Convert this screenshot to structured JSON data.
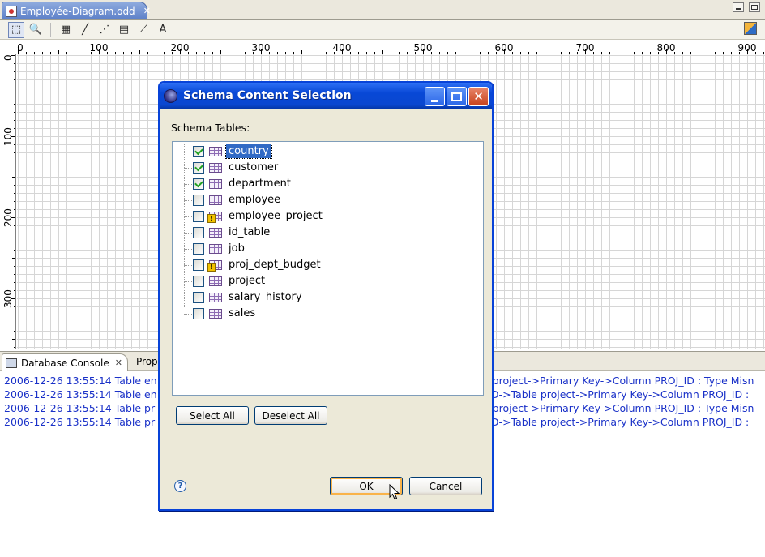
{
  "editor": {
    "tab_title": "Employée-Diagram.odd",
    "tab_close": "✕"
  },
  "toolbar": {
    "tools": [
      {
        "name": "select-tool",
        "glyph": "⬚"
      },
      {
        "name": "zoom-tool",
        "glyph": "🔍"
      },
      {
        "name": "table-tool",
        "glyph": "▦"
      },
      {
        "name": "line-tool",
        "glyph": "╱"
      },
      {
        "name": "dashed-line-tool",
        "glyph": "⋰"
      },
      {
        "name": "note-tool",
        "glyph": "▤"
      },
      {
        "name": "link-tool",
        "glyph": "⟋"
      },
      {
        "name": "text-tool",
        "glyph": "A"
      }
    ]
  },
  "ruler": {
    "h_labels": [
      "0",
      "100",
      "200",
      "300",
      "400",
      "500",
      "600",
      "700",
      "800",
      "900"
    ],
    "v_labels": [
      "0",
      "100",
      "200",
      "300"
    ]
  },
  "console": {
    "tab_label": "Database Console",
    "tab_close": "✕",
    "second_tab": "Prop",
    "lines_left": [
      "2006-12-26 13:55:14 Table en",
      "2006-12-26 13:55:14 Table en",
      "2006-12-26 13:55:14 Table pr",
      "2006-12-26 13:55:14 Table pr"
    ],
    "lines_right": [
      "e project->Primary Key->Column PROJ_ID : Type Misn",
      "_ID->Table project->Primary Key->Column PROJ_ID :",
      "e project->Primary Key->Column PROJ_ID : Type Misn",
      "_ID->Table project->Primary Key->Column PROJ_ID :"
    ]
  },
  "dialog": {
    "title": "Schema Content Selection",
    "section_label": "Schema Tables:",
    "tables": [
      {
        "name": "country",
        "checked": true,
        "warn": false,
        "selected": true
      },
      {
        "name": "customer",
        "checked": true,
        "warn": false,
        "selected": false
      },
      {
        "name": "department",
        "checked": true,
        "warn": false,
        "selected": false
      },
      {
        "name": "employee",
        "checked": false,
        "warn": false,
        "selected": false
      },
      {
        "name": "employee_project",
        "checked": false,
        "warn": true,
        "selected": false
      },
      {
        "name": "id_table",
        "checked": false,
        "warn": false,
        "selected": false
      },
      {
        "name": "job",
        "checked": false,
        "warn": false,
        "selected": false
      },
      {
        "name": "proj_dept_budget",
        "checked": false,
        "warn": true,
        "selected": false
      },
      {
        "name": "project",
        "checked": false,
        "warn": false,
        "selected": false
      },
      {
        "name": "salary_history",
        "checked": false,
        "warn": false,
        "selected": false
      },
      {
        "name": "sales",
        "checked": false,
        "warn": false,
        "selected": false
      }
    ],
    "select_all": "Select All",
    "deselect_all": "Deselect All",
    "ok": "OK",
    "cancel": "Cancel",
    "help": "?"
  },
  "colors": {
    "xp_title_blue": "#0848d6",
    "selection_blue": "#316ac5",
    "console_text": "#1a31c8",
    "grid_line": "#d6d6d6"
  }
}
